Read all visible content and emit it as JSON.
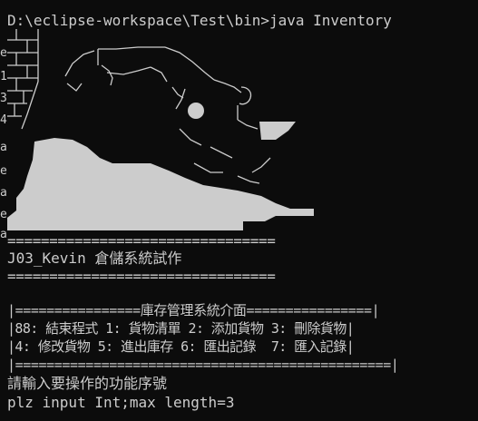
{
  "terminal": {
    "command_line": "D:\\eclipse-workspace\\Test\\bin>java Inventory",
    "left_edge_fragments": [
      "e",
      "1",
      "3",
      "4",
      "a",
      "e",
      "a",
      "e",
      "a"
    ],
    "banner": {
      "rule_top": "================================",
      "title": "J03_Kevin 倉儲系統試作",
      "rule_bottom": "================================"
    },
    "menu": {
      "header": "|================庫存管理系統介面================|",
      "row1": "|88: 結束程式 1: 貨物清單 2: 添加貨物 3: 刪除貨物|",
      "row2": "|4: 修改貨物 5: 進出庫存 6: 匯出記錄  7: 匯入記錄|",
      "footer": "|================================================|"
    },
    "prompt": "請輸入要操作的功能序號",
    "hint": "plz input Int;max length=3"
  },
  "colors": {
    "background": "#0c0c0c",
    "text": "#cccccc"
  }
}
